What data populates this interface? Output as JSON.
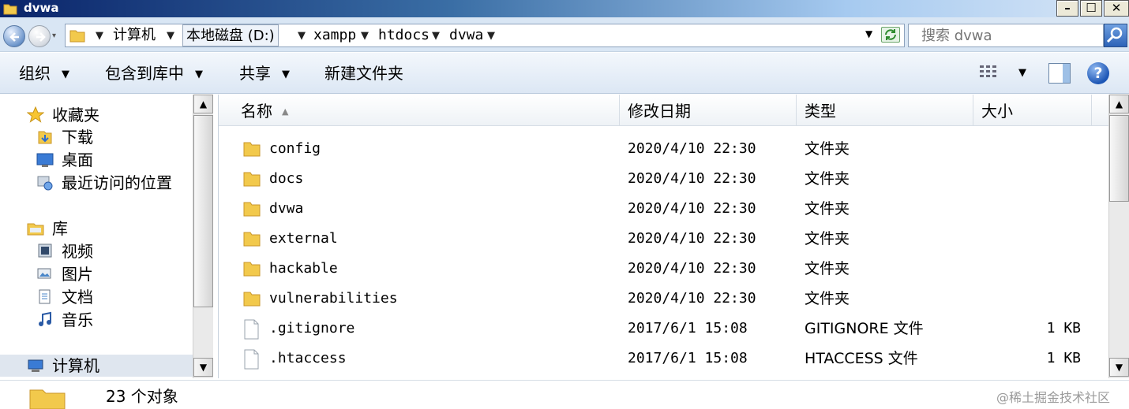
{
  "window": {
    "title": "dvwa"
  },
  "address": {
    "segments": [
      "计算机",
      "本地磁盘 (D:)",
      "xampp",
      "htdocs",
      "dvwa"
    ],
    "search_placeholder": "搜索 dvwa"
  },
  "toolbar": {
    "organize": "组织",
    "include_in_library": "包含到库中",
    "share": "共享",
    "new_folder": "新建文件夹"
  },
  "nav": {
    "favorites": "收藏夹",
    "downloads": "下载",
    "desktop": "桌面",
    "recent": "最近访问的位置",
    "libraries": "库",
    "videos": "视频",
    "pictures": "图片",
    "documents": "文档",
    "music": "音乐",
    "computer": "计算机"
  },
  "columns": {
    "name": "名称",
    "modified": "修改日期",
    "type": "类型",
    "size": "大小"
  },
  "files": [
    {
      "name": "config",
      "modified": "2020/4/10 22:30",
      "type": "文件夹",
      "size": "",
      "kind": "folder"
    },
    {
      "name": "docs",
      "modified": "2020/4/10 22:30",
      "type": "文件夹",
      "size": "",
      "kind": "folder"
    },
    {
      "name": "dvwa",
      "modified": "2020/4/10 22:30",
      "type": "文件夹",
      "size": "",
      "kind": "folder"
    },
    {
      "name": "external",
      "modified": "2020/4/10 22:30",
      "type": "文件夹",
      "size": "",
      "kind": "folder"
    },
    {
      "name": "hackable",
      "modified": "2020/4/10 22:30",
      "type": "文件夹",
      "size": "",
      "kind": "folder"
    },
    {
      "name": "vulnerabilities",
      "modified": "2020/4/10 22:30",
      "type": "文件夹",
      "size": "",
      "kind": "folder"
    },
    {
      "name": ".gitignore",
      "modified": "2017/6/1 15:08",
      "type": "GITIGNORE 文件",
      "size": "1 KB",
      "kind": "file"
    },
    {
      "name": ".htaccess",
      "modified": "2017/6/1 15:08",
      "type": "HTACCESS 文件",
      "size": "1 KB",
      "kind": "file"
    }
  ],
  "status": {
    "count_text": "23 个对象"
  },
  "watermark": "@稀土掘金技术社区"
}
